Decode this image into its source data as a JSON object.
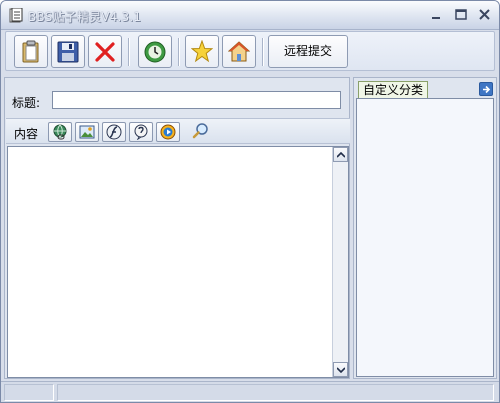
{
  "window": {
    "title": "BBS贴子精灵V4.3.1",
    "controls": [
      "minimize",
      "maximize",
      "close"
    ]
  },
  "toolbar": {
    "buttons": [
      {
        "name": "new",
        "icon": "clipboard-icon"
      },
      {
        "name": "save",
        "icon": "floppy-disk-icon"
      },
      {
        "name": "delete",
        "icon": "red-x-icon"
      },
      {
        "name": "refresh",
        "icon": "green-clock-icon"
      },
      {
        "name": "favorite",
        "icon": "star-icon"
      },
      {
        "name": "home",
        "icon": "house-icon"
      }
    ],
    "remote_submit_label": "远程提交"
  },
  "form": {
    "title_label": "标题:",
    "title_value": "",
    "content_label": "内容",
    "content_value": ""
  },
  "format_buttons": [
    {
      "name": "insert-link",
      "icon": "globe-link-icon"
    },
    {
      "name": "insert-image",
      "icon": "image-icon"
    },
    {
      "name": "insert-flash",
      "icon": "flash-icon"
    },
    {
      "name": "insert-emote",
      "icon": "speech-icon"
    },
    {
      "name": "insert-media",
      "icon": "media-play-icon"
    }
  ],
  "sidebar": {
    "tab_label": "自定义分类"
  },
  "colors": {
    "accent": "#3f76c4",
    "window_bg": "#d8deea",
    "tab_bg": "#f0f6e7",
    "delete_red": "#e02020"
  }
}
